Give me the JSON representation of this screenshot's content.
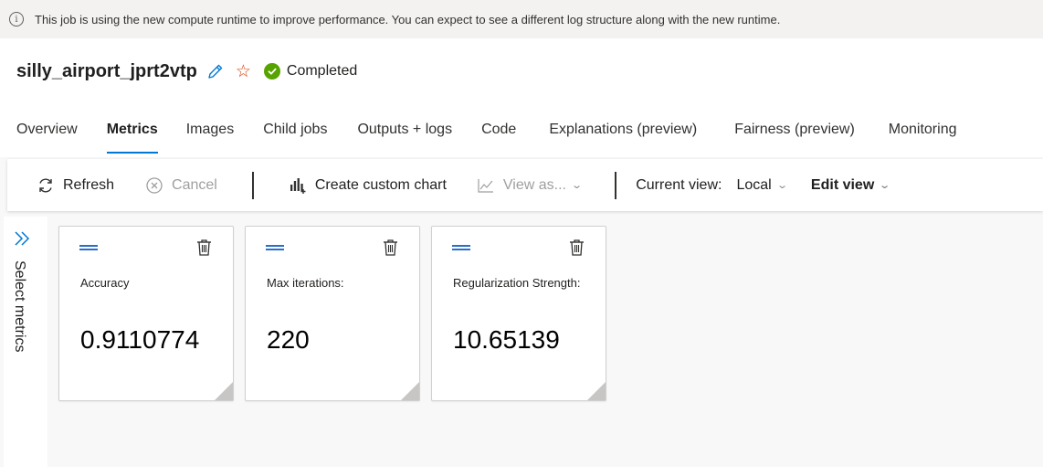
{
  "banner": {
    "text": "This job is using the new compute runtime to improve performance. You can expect to see a different log structure along with the new runtime."
  },
  "header": {
    "job_name": "silly_airport_jprt2vtp",
    "status": "Completed"
  },
  "tabs": [
    {
      "label": "Overview"
    },
    {
      "label": "Metrics",
      "active": true
    },
    {
      "label": "Images"
    },
    {
      "label": "Child jobs"
    },
    {
      "label": "Outputs + logs"
    },
    {
      "label": "Code"
    },
    {
      "label": "Explanations (preview)"
    },
    {
      "label": "Fairness (preview)"
    },
    {
      "label": "Monitoring"
    }
  ],
  "toolbar": {
    "refresh": "Refresh",
    "cancel": "Cancel",
    "create_chart": "Create custom chart",
    "view_as": "View as...",
    "current_view_label": "Current view:",
    "current_view_value": "Local",
    "edit_view": "Edit view"
  },
  "side_panel": {
    "label": "Select metrics"
  },
  "cards": [
    {
      "label": "Accuracy",
      "value": "0.9110774"
    },
    {
      "label": "Max iterations:",
      "value": "220"
    },
    {
      "label": "Regularization Strength:",
      "value": "10.65139"
    }
  ],
  "colors": {
    "accent": "#0078d4",
    "success": "#57a300",
    "star": "#d83b01",
    "banner_bg": "#f3f2f1"
  }
}
